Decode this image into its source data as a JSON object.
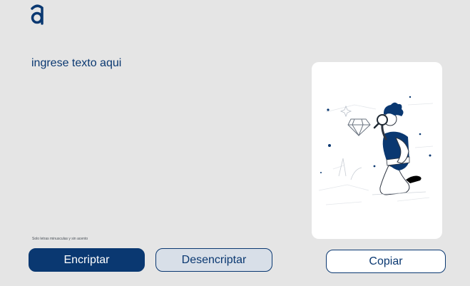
{
  "logo": {
    "icon": "alura-a-logo-icon",
    "color": "#0a3871"
  },
  "input": {
    "placeholder": "ingrese texto aqui",
    "value": ""
  },
  "hint": {
    "text": "Solo letras minusculas y sin acento"
  },
  "buttons": {
    "encrypt_label": "Encriptar",
    "decrypt_label": "Desencriptar",
    "copy_label": "Copiar"
  },
  "output": {
    "illustration": "person-with-magnifying-glass-illustration"
  },
  "colors": {
    "background": "#e5e5e5",
    "primary": "#0a3871",
    "secondary_button": "#d8dfe8",
    "panel": "#ffffff"
  }
}
